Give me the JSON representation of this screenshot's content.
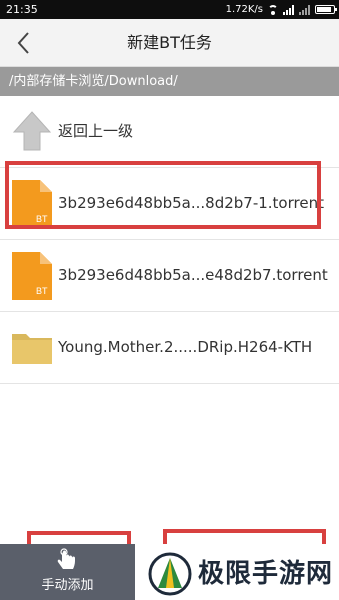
{
  "status_bar": {
    "time": "21:35",
    "speed": "1.72K/s"
  },
  "header": {
    "title": "新建BT任务"
  },
  "path": "/内部存储卡浏览/Download/",
  "files": [
    {
      "name": "返回上一级",
      "type": "up"
    },
    {
      "name": "3b293e6d48bb5a...8d2b7-1.torrent",
      "type": "torrent",
      "badge": "BT"
    },
    {
      "name": "3b293e6d48bb5a...e48d2b7.torrent",
      "type": "torrent",
      "badge": "BT"
    },
    {
      "name": "Young.Mother.2.....DRip.H264-KTH",
      "type": "folder"
    }
  ],
  "footer": {
    "add_manual_label": "手动添加"
  },
  "watermark": {
    "name": "极限手游网"
  },
  "colors": {
    "highlight": "#d8403f",
    "torrent_icon": "#f39a1e",
    "folder_icon": "#e8c66a"
  }
}
